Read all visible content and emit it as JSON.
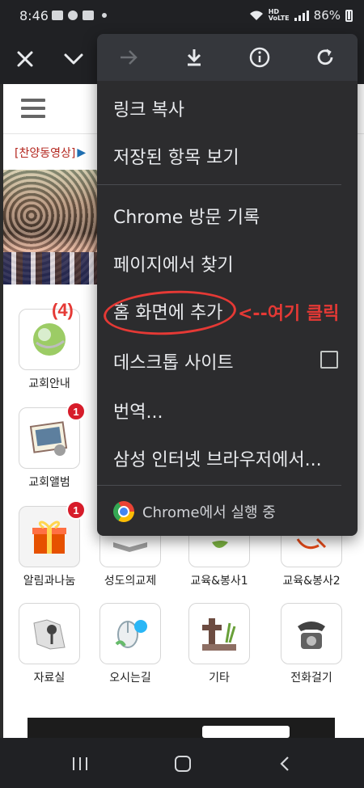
{
  "status_bar": {
    "time": "8:46",
    "battery": "86%"
  },
  "toolbar": {
    "close_icon": "close-icon",
    "expand_icon": "chevron-down-icon"
  },
  "page": {
    "notice_tag": "[찬양동영상]",
    "menu": [
      {
        "label": "교회안내",
        "icon": "globe-icon"
      },
      {
        "label": "교회앨범",
        "icon": "photo-album-icon",
        "badge": "1"
      },
      {
        "label": "알림과나눔",
        "icon": "gift-icon",
        "badge": "1"
      },
      {
        "label": "성도의교제",
        "icon": "book-icon"
      },
      {
        "label": "교육&봉사1",
        "icon": "leaf-icon"
      },
      {
        "label": "교육&봉사2",
        "icon": "heart-icon"
      },
      {
        "label": "자료실",
        "icon": "map-pin-icon"
      },
      {
        "label": "오시는길",
        "icon": "mouse-icon"
      },
      {
        "label": "기타",
        "icon": "cross-icon"
      },
      {
        "label": "전화걸기",
        "icon": "telephone-icon"
      }
    ]
  },
  "overflow_menu": {
    "top_icons": [
      "forward-arrow-icon",
      "download-icon",
      "info-icon",
      "refresh-icon"
    ],
    "items": [
      "링크 복사",
      "저장된 항목 보기",
      "Chrome 방문 기록",
      "페이지에서 찾기",
      "홈 화면에 추가",
      "데스크톱 사이트",
      "번역...",
      "삼성 인터넷 브라우저에서..."
    ],
    "footer": "Chrome에서 실행 중"
  },
  "annotation": {
    "step": "(4)",
    "callout": "<--여기 클릭"
  },
  "colors": {
    "annotation_red": "#e53935",
    "menu_bg": "#2c2c2e",
    "toolbar_bg": "#202124"
  }
}
